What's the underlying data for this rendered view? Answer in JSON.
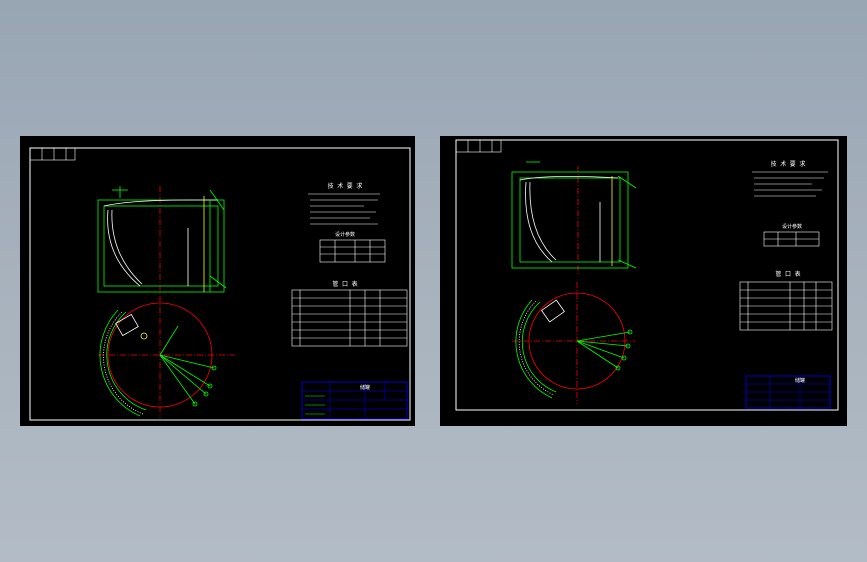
{
  "colors": {
    "background": "#a2adb9",
    "sheet": "#000000",
    "frame": "#ffffff",
    "outline": "#00ff00",
    "centerline": "#ff0000",
    "titleblock": "#0000ff",
    "text": "#ffffff",
    "accent": "#ffff00"
  },
  "drawings": [
    {
      "id": "left",
      "notes_title": "技 术 要 求",
      "table_title": "管 口 表",
      "small_table_title": "设计参数",
      "titleblock_name": "储罐"
    },
    {
      "id": "right",
      "notes_title": "技 术 要 求",
      "table_title": "管 口 表",
      "small_table_title": "设计参数",
      "titleblock_name": "储罐"
    }
  ]
}
